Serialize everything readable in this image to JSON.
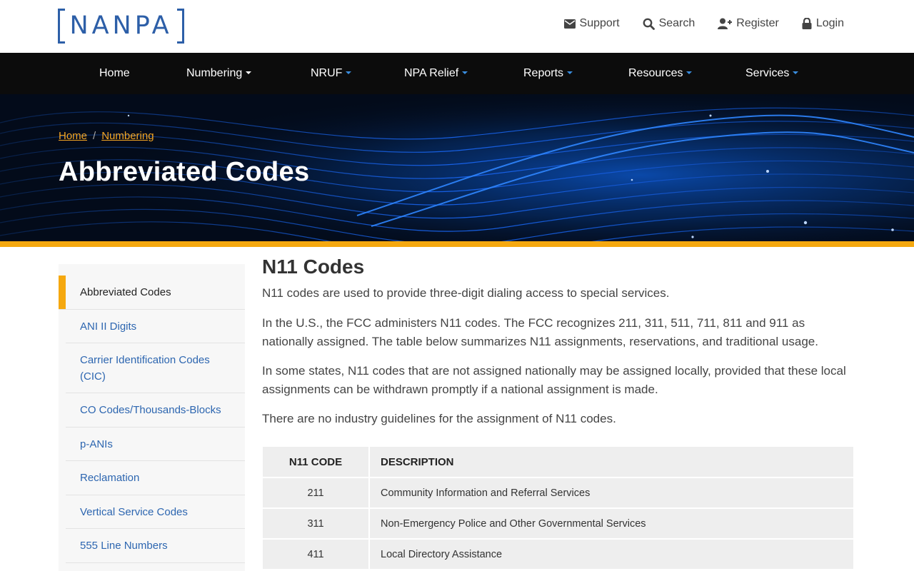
{
  "logo": {
    "text": "NANPA"
  },
  "utility_nav": [
    {
      "label": "Support",
      "icon": "envelope-icon"
    },
    {
      "label": "Search",
      "icon": "search-icon"
    },
    {
      "label": "Register",
      "icon": "user-plus-icon"
    },
    {
      "label": "Login",
      "icon": "lock-icon"
    }
  ],
  "main_nav": [
    {
      "label": "Home"
    },
    {
      "label": "Numbering"
    },
    {
      "label": "NRUF"
    },
    {
      "label": "NPA Relief"
    },
    {
      "label": "Reports"
    },
    {
      "label": "Resources"
    },
    {
      "label": "Services"
    }
  ],
  "breadcrumb": {
    "items": [
      "Home",
      "Numbering"
    ],
    "separator": "/"
  },
  "hero": {
    "title": "Abbreviated Codes"
  },
  "sidebar": {
    "items": [
      {
        "label": "Abbreviated Codes",
        "active": true
      },
      {
        "label": "ANI II Digits"
      },
      {
        "label": "Carrier Identification Codes (CIC)"
      },
      {
        "label": "CO Codes/Thousands-Blocks"
      },
      {
        "label": "p-ANIs"
      },
      {
        "label": "Reclamation"
      },
      {
        "label": "Vertical Service Codes"
      },
      {
        "label": "555 Line Numbers"
      }
    ]
  },
  "content": {
    "heading": "N11 Codes",
    "paragraphs": [
      "N11 codes are used to provide three-digit dialing access to special services.",
      "In the U.S., the FCC administers N11 codes. The FCC recognizes 211, 311, 511, 711, 811 and 911 as nationally assigned. The table below summarizes N11 assignments, reservations, and traditional usage.",
      "In some states, N11 codes that are not assigned nationally may be assigned locally, provided that these local assignments can be withdrawn promptly if a national assignment is made.",
      "There are no industry guidelines for the assignment of N11 codes."
    ]
  },
  "table": {
    "headers": [
      "N11 CODE",
      "DESCRIPTION"
    ],
    "rows": [
      [
        "211",
        "Community Information and Referral Services"
      ],
      [
        "311",
        "Non-Emergency Police and Other Governmental Services"
      ],
      [
        "411",
        "Local Directory Assistance"
      ]
    ]
  },
  "colors": {
    "brand_blue": "#2d5fa8",
    "link_blue": "#2d66b0",
    "accent_gold": "#f5a80f",
    "nav_black": "#0c0c0c"
  }
}
